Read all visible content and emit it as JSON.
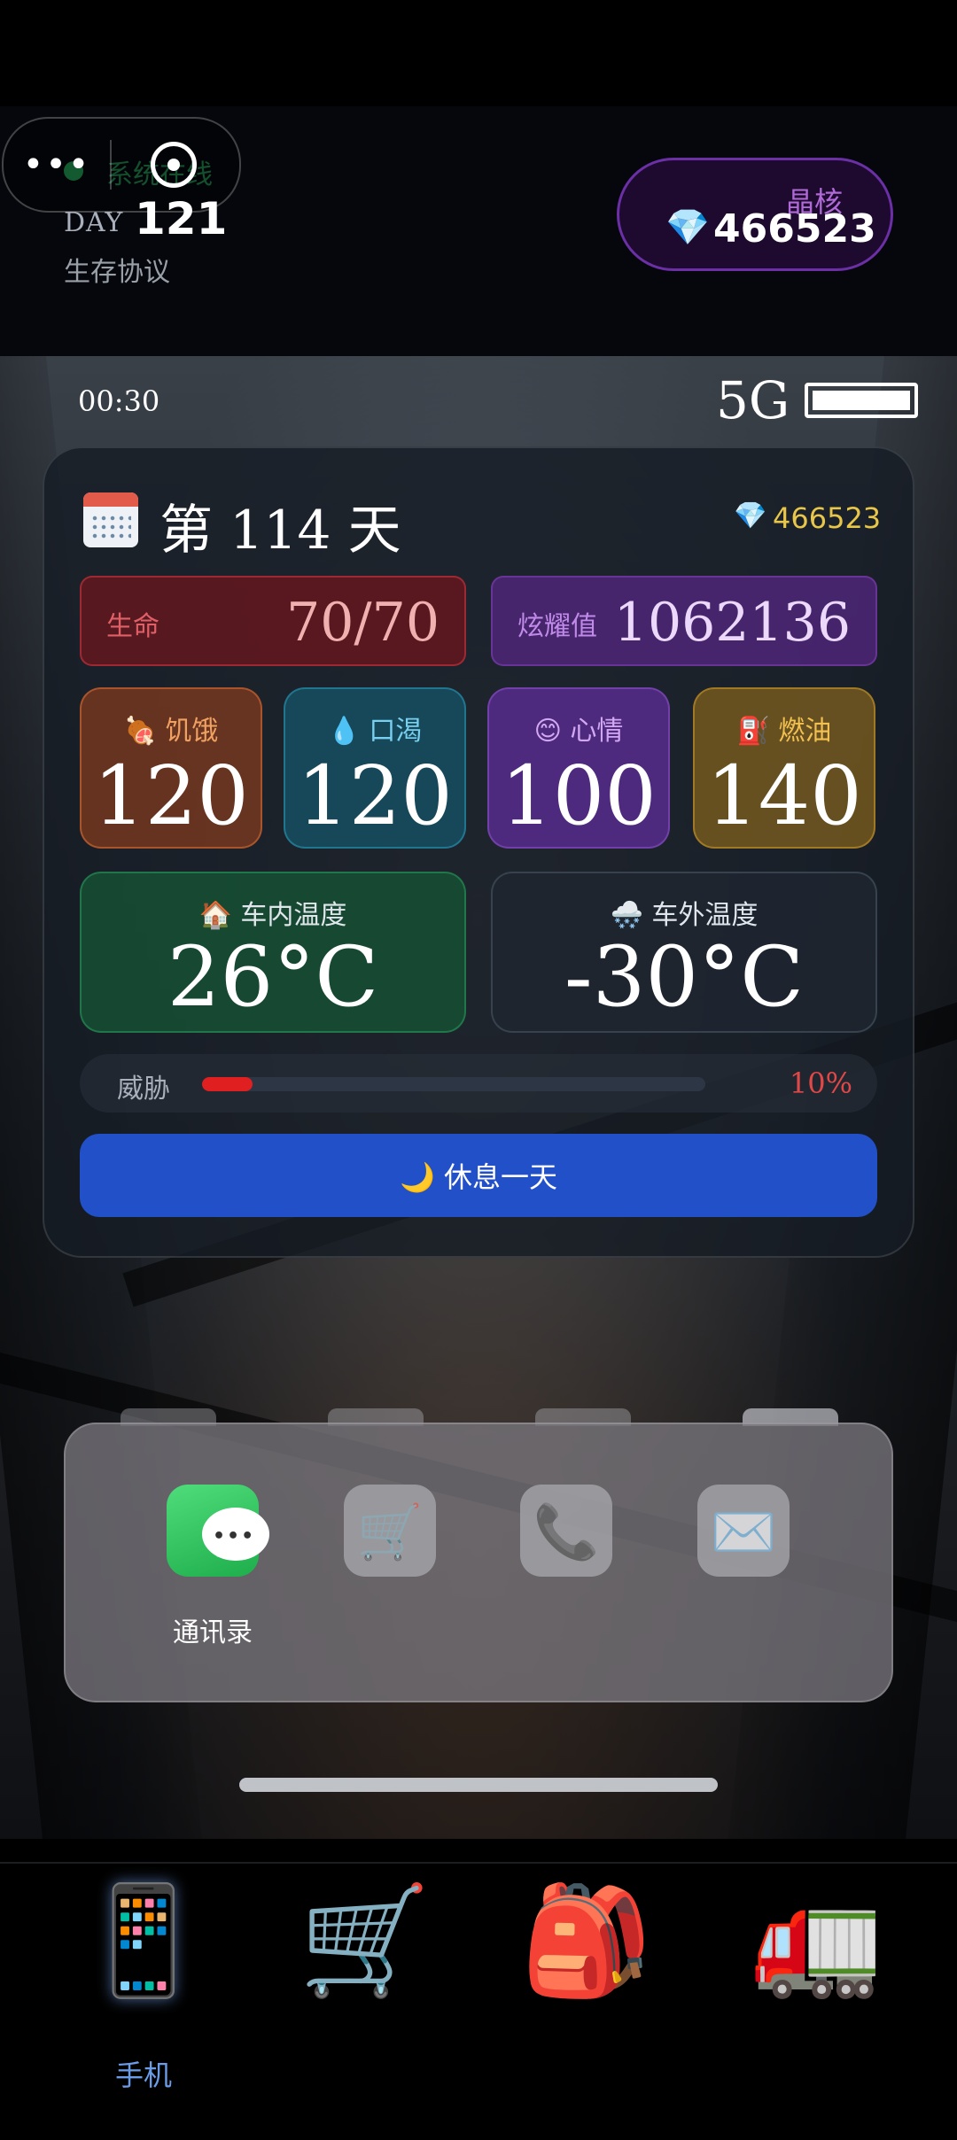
{
  "header": {
    "status_text": "系统在线",
    "day_label": "DAY",
    "day_number": "121",
    "subtitle": "生存协议",
    "crystal_label": "晶核",
    "crystal_value": "466523"
  },
  "status_bar": {
    "time": "00:30",
    "network": "5G"
  },
  "card": {
    "title": "第 114 天",
    "crystal_value": "466523",
    "life": {
      "label": "生命",
      "value": "70/70"
    },
    "fame": {
      "label": "炫耀值",
      "value": "1062136"
    },
    "stats": [
      {
        "label": "🍖 饥饿",
        "value": "120"
      },
      {
        "label": "💧 口渴",
        "value": "120"
      },
      {
        "label": "😊 心情",
        "value": "100"
      },
      {
        "label": "⛽ 燃油",
        "value": "140"
      }
    ],
    "inside_temp": {
      "label": "🏠 车内温度",
      "value": "26°C"
    },
    "outside_temp": {
      "label": "🌨️ 车外温度",
      "value": "-30°C"
    },
    "threat": {
      "label": "威胁",
      "value": "10%",
      "level": 0.1
    },
    "rest_button": "🌙 休息一天"
  },
  "dock": {
    "apps": [
      {
        "name": "messages",
        "label": "通讯录"
      },
      {
        "name": "shop"
      },
      {
        "name": "phone"
      },
      {
        "name": "mail"
      }
    ]
  },
  "nav": {
    "items": [
      {
        "icon": "mobile-phone-icon",
        "label": "手机"
      },
      {
        "icon": "shopping-cart-icon"
      },
      {
        "icon": "backpack-icon"
      },
      {
        "icon": "truck-icon"
      }
    ]
  },
  "colors": {
    "accent_blue": "#2250c8",
    "crystal_gold": "#e8c64a",
    "threat_red": "#e02020",
    "nav_active": "#6a9ce8"
  }
}
